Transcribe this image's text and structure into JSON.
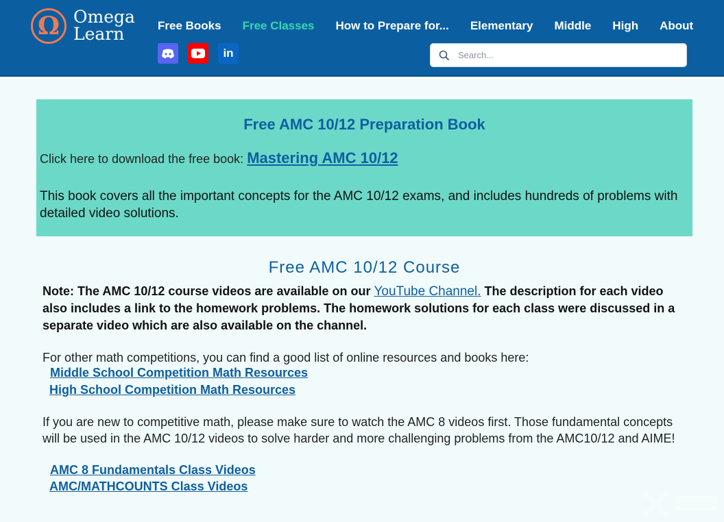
{
  "header": {
    "logo_line1": "Omega",
    "logo_line2": "Learn",
    "nav": [
      {
        "label": "Free Books"
      },
      {
        "label": "Free Classes"
      },
      {
        "label": "How to Prepare for..."
      },
      {
        "label": "Elementary"
      },
      {
        "label": "Middle"
      },
      {
        "label": "High"
      },
      {
        "label": "About"
      }
    ],
    "social": [
      "discord-icon",
      "youtube-icon",
      "linkedin-icon"
    ],
    "search_placeholder": "Search..."
  },
  "promo": {
    "title": "Free AMC 10/12 Preparation Book",
    "download_prefix": "Click here to download the free book: ",
    "download_link": "Mastering AMC 10/12",
    "description": "This book covers all the important concepts for the AMC 10/12 exams, and includes hundreds of problems with detailed video solutions."
  },
  "course": {
    "title": "Free AMC 10/12 Course",
    "note_prefix": "Note: The AMC 10/12 course videos are available on our ",
    "note_link": "YouTube Channel.",
    "note_suffix": " The description for each video also includes a link to the homework problems. The homework solutions for each class were discussed in a separate video which are also available on the channel.",
    "other_text": "For other math competitions, you can find a good list of online resources and books here:",
    "link_middle": "Middle School Competition Math Resources",
    "link_high": "High School Competition Math Resources",
    "new_text": "If you are new to competitive math, please make sure to watch the AMC 8 videos first. Those fundamental concepts will be used in the AMC 10/12 videos to solve harder and more challenging problems from the AMC10/12 and AIME!",
    "link_amc8": "AMC 8 Fundamentals Class Videos",
    "link_mathcounts": "AMC/MATHCOUNTS Class Videos"
  },
  "colors": {
    "header_bg": "#0b5fa0",
    "accent_active": "#38d6b1",
    "promo_bg": "#6cd9c8",
    "link": "#0f5fa0",
    "logo": "#ee7a55"
  }
}
